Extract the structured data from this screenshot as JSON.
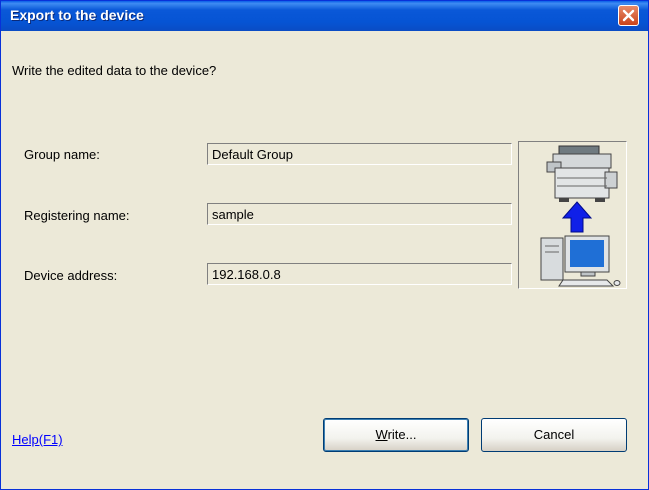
{
  "window": {
    "title": "Export to the device"
  },
  "icons": {
    "close": "close-icon",
    "device": "copier-export-illustration"
  },
  "prompt": "Write the edited data to the device?",
  "fields": [
    {
      "label": "Group name:",
      "value": "Default Group"
    },
    {
      "label": "Registering name:",
      "value": "sample"
    },
    {
      "label": "Device address:",
      "value": "192.168.0.8"
    }
  ],
  "footer": {
    "help_link": "Help(F1)",
    "write_underlined": "W",
    "write_rest": "rite...",
    "cancel_label": "Cancel"
  },
  "colors": {
    "title_bar": "#0a58d8",
    "dialog_bg": "#ece9d8",
    "close_button": "#d7582f",
    "link": "#0000ff"
  }
}
